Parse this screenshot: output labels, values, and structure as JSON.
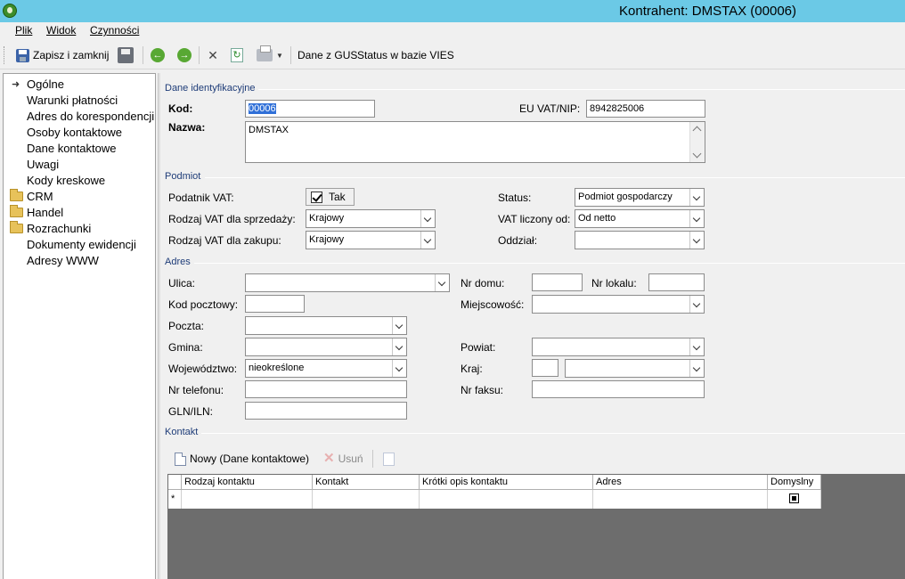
{
  "window": {
    "title": "Kontrahent: DMSTAX (00006)"
  },
  "menu": [
    {
      "label": "Plik"
    },
    {
      "label": "Widok"
    },
    {
      "label": "Czynności"
    }
  ],
  "toolbar": {
    "save_close": "Zapisz i zamknij",
    "gus": "Dane z GUS",
    "vies": "Status w bazie VIES"
  },
  "sidebar": {
    "items": [
      {
        "label": "Ogólne",
        "icon": "arrow-icon"
      },
      {
        "label": "Warunki płatności"
      },
      {
        "label": "Adres do korespondencji"
      },
      {
        "label": "Osoby kontaktowe"
      },
      {
        "label": "Dane kontaktowe"
      },
      {
        "label": "Uwagi"
      },
      {
        "label": "Kody kreskowe"
      },
      {
        "label": "CRM",
        "icon": "folder-icon"
      },
      {
        "label": "Handel",
        "icon": "folder-icon"
      },
      {
        "label": "Rozrachunki",
        "icon": "folder-icon"
      },
      {
        "label": "Dokumenty ewidencji"
      },
      {
        "label": "Adresy WWW"
      }
    ]
  },
  "ident": {
    "section": "Dane identyfikacyjne",
    "kod_label": "Kod:",
    "kod_value": "00006",
    "nip_label": "EU VAT/NIP:",
    "nip_value": "8942825006",
    "nazwa_label": "Nazwa:",
    "nazwa_value": "DMSTAX"
  },
  "podmiot": {
    "section": "Podmiot",
    "vat_label": "Podatnik VAT:",
    "vat_value": "Tak",
    "vat_checked": true,
    "status_label": "Status:",
    "status_value": "Podmiot gospodarczy",
    "sprzedaz_label": "Rodzaj VAT dla sprzedaży:",
    "sprzedaz_value": "Krajowy",
    "liczony_label": "VAT liczony od:",
    "liczony_value": "Od netto",
    "zakup_label": "Rodzaj VAT dla zakupu:",
    "zakup_value": "Krajowy",
    "oddzial_label": "Oddział:",
    "oddzial_value": ""
  },
  "adres": {
    "section": "Adres",
    "ulica_label": "Ulica:",
    "nr_domu_label": "Nr domu:",
    "nr_lokalu_label": "Nr lokalu:",
    "kod_pocztowy_label": "Kod pocztowy:",
    "miejscowosc_label": "Miejscowość:",
    "poczta_label": "Poczta:",
    "gmina_label": "Gmina:",
    "powiat_label": "Powiat:",
    "wojewodztwo_label": "Województwo:",
    "wojewodztwo_value": "nieokreślone",
    "kraj_label": "Kraj:",
    "telefon_label": "Nr telefonu:",
    "faks_label": "Nr faksu:",
    "gln_label": "GLN/ILN:"
  },
  "kontakt": {
    "section": "Kontakt",
    "new_button": "Nowy (Dane kontaktowe)",
    "delete_button": "Usuń",
    "columns": [
      "Rodzaj kontaktu",
      "Kontakt",
      "Krótki opis kontaktu",
      "Adres",
      "Domyslny"
    ],
    "new_row_marker": "*"
  }
}
